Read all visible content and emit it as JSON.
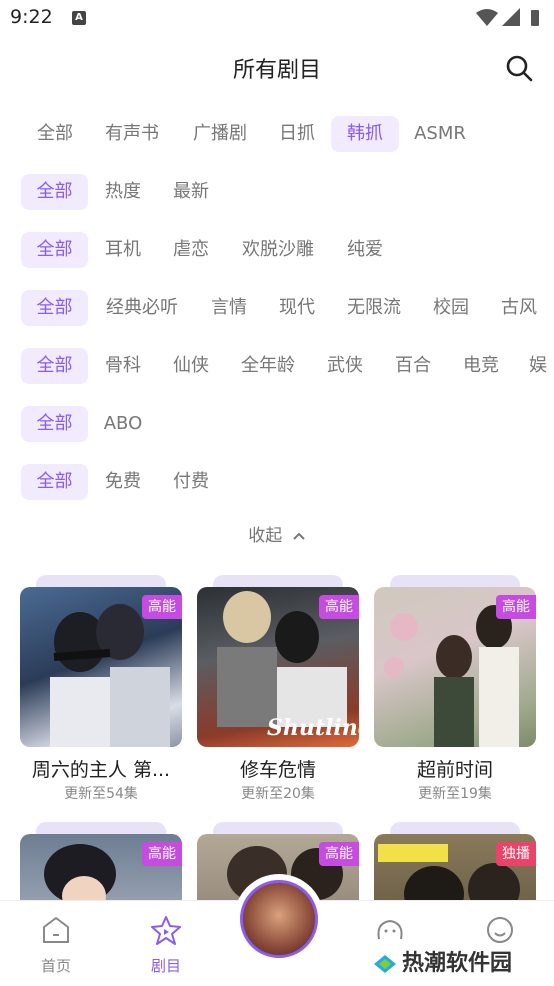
{
  "status": {
    "time": "9:22"
  },
  "header": {
    "title": "所有剧目"
  },
  "filters": {
    "row1": [
      "全部",
      "有声书",
      "广播剧",
      "日抓",
      "韩抓",
      "ASMR"
    ],
    "row2": [
      "全部",
      "热度",
      "最新"
    ],
    "row3": [
      "全部",
      "耳机",
      "虐恋",
      "欢脱沙雕",
      "纯爱"
    ],
    "row4": [
      "全部",
      "经典必听",
      "言情",
      "现代",
      "无限流",
      "校园",
      "古风"
    ],
    "row5": [
      "全部",
      "骨科",
      "仙侠",
      "全年龄",
      "武侠",
      "百合",
      "电竞",
      "娱"
    ],
    "row6": [
      "全部",
      "ABO"
    ],
    "row7": [
      "全部",
      "免费",
      "付费"
    ],
    "collapse_label": "收起"
  },
  "cards": [
    {
      "title": "周六的主人 第...",
      "sub": "更新至54集",
      "badge": "高能",
      "overlay": ""
    },
    {
      "title": "修车危情",
      "sub": "更新至20集",
      "badge": "高能",
      "overlay": "Shutline"
    },
    {
      "title": "超前时间",
      "sub": "更新至19集",
      "badge": "高能",
      "overlay": ""
    },
    {
      "badge": "高能"
    },
    {
      "badge": "高能"
    },
    {
      "badge": "独播"
    }
  ],
  "tabbar": {
    "home": "首页",
    "drama": "剧目"
  },
  "watermark": "热潮软件园",
  "colors": {
    "accent": "#8a5cf0",
    "badge": "#c64be0",
    "badge_exclusive": "#e94369"
  }
}
